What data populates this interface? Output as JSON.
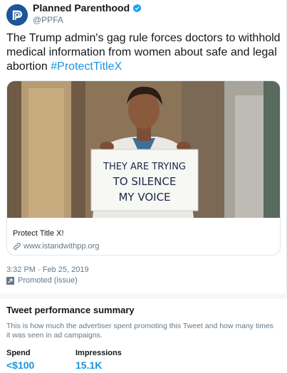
{
  "tweet": {
    "author_name": "Planned Parenthood",
    "author_handle": "@PPFA",
    "text_main": "The Trump admin's gag rule forces doctors to withhold medical information from women about safe and legal abortion ",
    "hashtag": "#ProtectTitleX",
    "sign_line1": "THEY ARE TRYING",
    "sign_line2": "TO SILENCE",
    "sign_line3": "MY VOICE",
    "card_title": "Protect Title X!",
    "card_url": "www.istandwithpp.org",
    "timestamp": "3:32 PM · Feb 25, 2019",
    "promoted": "Promoted (issue)"
  },
  "performance": {
    "title": "Tweet performance summary",
    "description": "This is how much the advertiser spent promoting this Tweet and how many times it was seen in ad campaigns.",
    "spend_label": "Spend",
    "spend_value": "<$100",
    "impressions_label": "Impressions",
    "impressions_value": "15.1K"
  },
  "icons": {
    "avatar": "planned-parenthood-logo-icon",
    "verified": "verified-badge-icon",
    "link": "link-icon",
    "promoted": "promoted-arrow-icon"
  },
  "colors": {
    "link_blue": "#1b95e0",
    "brand_blue": "#1e5596",
    "text_primary": "#14171a",
    "text_secondary": "#657786"
  }
}
